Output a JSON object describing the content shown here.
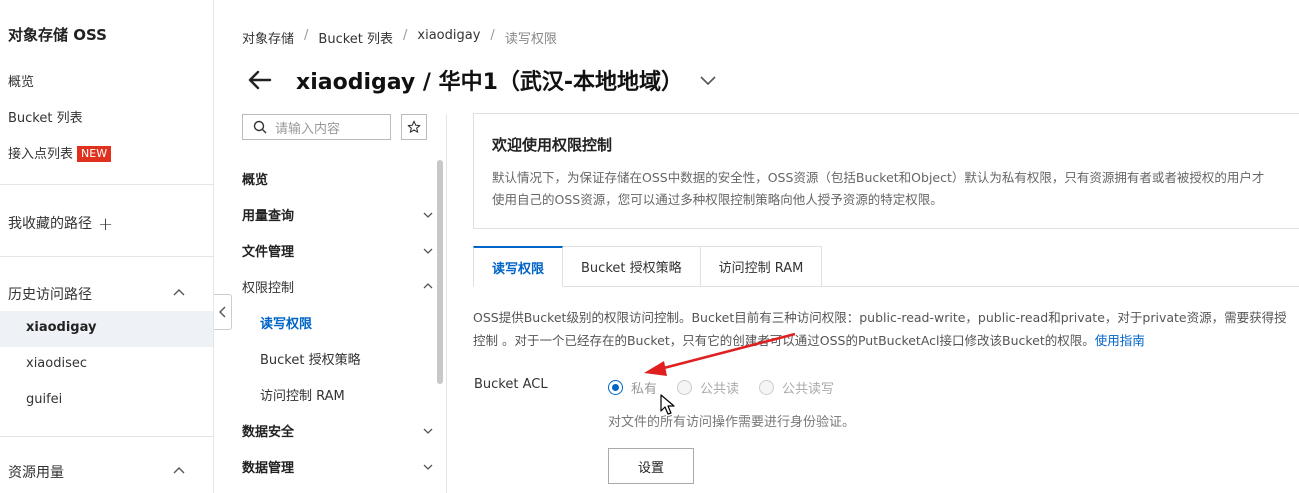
{
  "global_sidebar": {
    "title": "对象存储 OSS",
    "items": [
      "概览",
      "Bucket 列表",
      "接入点列表"
    ],
    "new_badge": "NEW",
    "favorites_label": "我收藏的路径",
    "favorites_add": "+",
    "history_label": "历史访问路径",
    "history_items": [
      "xiaodigay",
      "xiaodisec",
      "guifei"
    ],
    "resource_label": "资源用量"
  },
  "breadcrumb": [
    "对象存储",
    "Bucket 列表",
    "xiaodigay",
    "读写权限"
  ],
  "breadcrumb_sep": "/",
  "header": {
    "title": "xiaodigay / 华中1（武汉-本地地域）"
  },
  "bucket_nav": {
    "search_placeholder": "请输入内容",
    "items": [
      {
        "label": "概览"
      },
      {
        "label": "用量查询"
      },
      {
        "label": "文件管理"
      },
      {
        "label": "权限控制"
      },
      {
        "label": "读写权限"
      },
      {
        "label": "Bucket 授权策略"
      },
      {
        "label": "访问控制 RAM"
      },
      {
        "label": "数据安全"
      },
      {
        "label": "数据管理"
      }
    ]
  },
  "welcome": {
    "title": "欢迎使用权限控制",
    "line1": "默认情况下，为保证存储在OSS中数据的安全性，OSS资源（包括Bucket和Object）默认为私有权限，只有资源拥有者或者被授权的用户才",
    "line2": "使用自己的OSS资源，您可以通过多种权限控制策略向他人授予资源的特定权限。"
  },
  "tabs": [
    "读写权限",
    "Bucket 授权策略",
    "访问控制 RAM"
  ],
  "description": {
    "line1": "OSS提供Bucket级别的权限访问控制。Bucket目前有三种访问权限：public-read-write，public-read和private，对于private资源，需要获得授",
    "line2": "控制 。对于一个已经存在的Bucket，只有它的创建者可以通过OSS的PutBucketAcl接口修改该Bucket的权限。",
    "link": "使用指南"
  },
  "acl": {
    "label": "Bucket ACL",
    "options": [
      "私有",
      "公共读",
      "公共读写"
    ],
    "selected": "私有",
    "hint": "对文件的所有访问操作需要进行身份验证。",
    "button": "设置"
  },
  "colors": {
    "accent": "#0064c8",
    "badge": "#e0311f",
    "arrow": "#e02020"
  }
}
